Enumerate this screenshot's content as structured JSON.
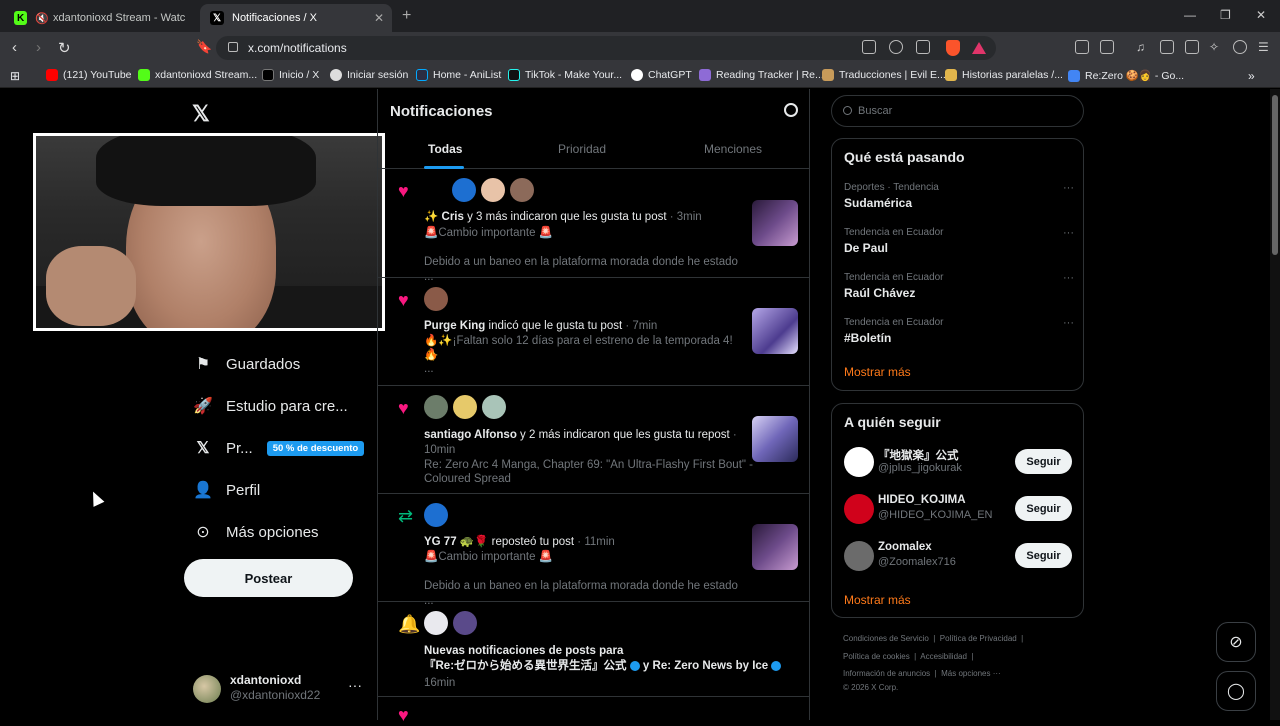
{
  "browser": {
    "tabs": [
      {
        "title": "xdantonioxd Stream - Watch Live",
        "active": false
      },
      {
        "title": "Notificaciones / X",
        "active": true
      }
    ],
    "url": "x.com/notifications",
    "bookmarks": [
      "(121) YouTube",
      "xdantonioxd Stream...",
      "Inicio / X",
      "Iniciar sesión",
      "Home - AniList",
      "TikTok - Make Your...",
      "ChatGPT",
      "Reading Tracker | Re...",
      "Traducciones | Evil E...",
      "Historias paralelas /...",
      "Re:Zero 🍪👩 - Go..."
    ]
  },
  "sidebar": {
    "items": [
      {
        "label": "Guardados",
        "icon": "bookmark-icon"
      },
      {
        "label": "Estudio para cre...",
        "icon": "rocket-icon"
      },
      {
        "label": "Pr...",
        "icon": "x-icon",
        "badge": "50 % de descuento"
      },
      {
        "label": "Perfil",
        "icon": "person-icon"
      },
      {
        "label": "Más opciones",
        "icon": "more-circle-icon"
      }
    ],
    "post_button": "Postear",
    "account": {
      "name": "xdantonioxd",
      "handle": "@xdantonioxd22"
    }
  },
  "notifications": {
    "title": "Notificaciones",
    "tabs": [
      "Todas",
      "Prioridad",
      "Menciones"
    ],
    "items": [
      {
        "type": "like",
        "actor": "✨ Cris",
        "action": " y 3 más indicaron que les gusta tu post",
        "time": " · 3min",
        "preview": "🚨Cambio importante 🚨",
        "excerpt": "Debido a un baneo en la plataforma morada donde he estado ..."
      },
      {
        "type": "like",
        "actor": "Purge King",
        "action": " indicó que le gusta tu post",
        "time": " · 7min",
        "preview": "🔥✨¡Faltan solo 12 días para el estreno de la temporada 4!✨",
        "preview2": "🔥",
        "excerpt": "..."
      },
      {
        "type": "like",
        "actor": "santiago Alfonso",
        "action": " y 2 más indicaron que les gusta tu repost",
        "time": " ·",
        "time2": "10min",
        "preview": "Re: Zero Arc 4 Manga, Chapter 69: \"An Ultra-Flashy First Bout\" -",
        "preview2": "Coloured Spread"
      },
      {
        "type": "repost",
        "actor": "YG 77 🐢🌹",
        "action": " reposteó tu post",
        "time": " · 11min",
        "preview": "🚨Cambio importante 🚨",
        "excerpt": "Debido a un baneo en la plataforma morada donde he estado ..."
      },
      {
        "type": "bell",
        "line1": "Nuevas notificaciones de posts para",
        "line2a": "『Re:ゼロから始める異世界生活』公式",
        "line2b": " y Re: Zero News by Ice",
        "line2c": " ·",
        "time": "16min"
      }
    ]
  },
  "right": {
    "search_placeholder": "Buscar",
    "trends_title": "Qué está pasando",
    "trends": [
      {
        "meta": "Deportes · Tendencia",
        "name": "Sudamérica"
      },
      {
        "meta": "Tendencia en Ecuador",
        "name": "De Paul"
      },
      {
        "meta": "Tendencia en Ecuador",
        "name": "Raúl Chávez"
      },
      {
        "meta": "Tendencia en Ecuador",
        "name": "#Boletín"
      }
    ],
    "show_more": "Mostrar más",
    "follow_title": "A quién seguir",
    "follow": [
      {
        "name": "『地獄楽』公式",
        "handle": "@jplus_jigokurak"
      },
      {
        "name": "HIDEO_KOJIMA",
        "handle": "@HIDEO_KOJIMA_EN"
      },
      {
        "name": "Zoomalex",
        "handle": "@Zoomalex716"
      }
    ],
    "follow_button": "Seguir",
    "footer": {
      "row1": [
        "Condiciones de Servicio",
        "Política de Privacidad"
      ],
      "row2": [
        "Política de cookies",
        "Accesibilidad"
      ],
      "row3": [
        "Información de anuncios",
        "Más opciones ···"
      ],
      "copyright": "© 2026 X Corp."
    }
  },
  "colors": {
    "accent": "#1d9bf0",
    "like": "#f91880",
    "repost": "#00ba7c",
    "show_more": "#ff7a1a"
  }
}
